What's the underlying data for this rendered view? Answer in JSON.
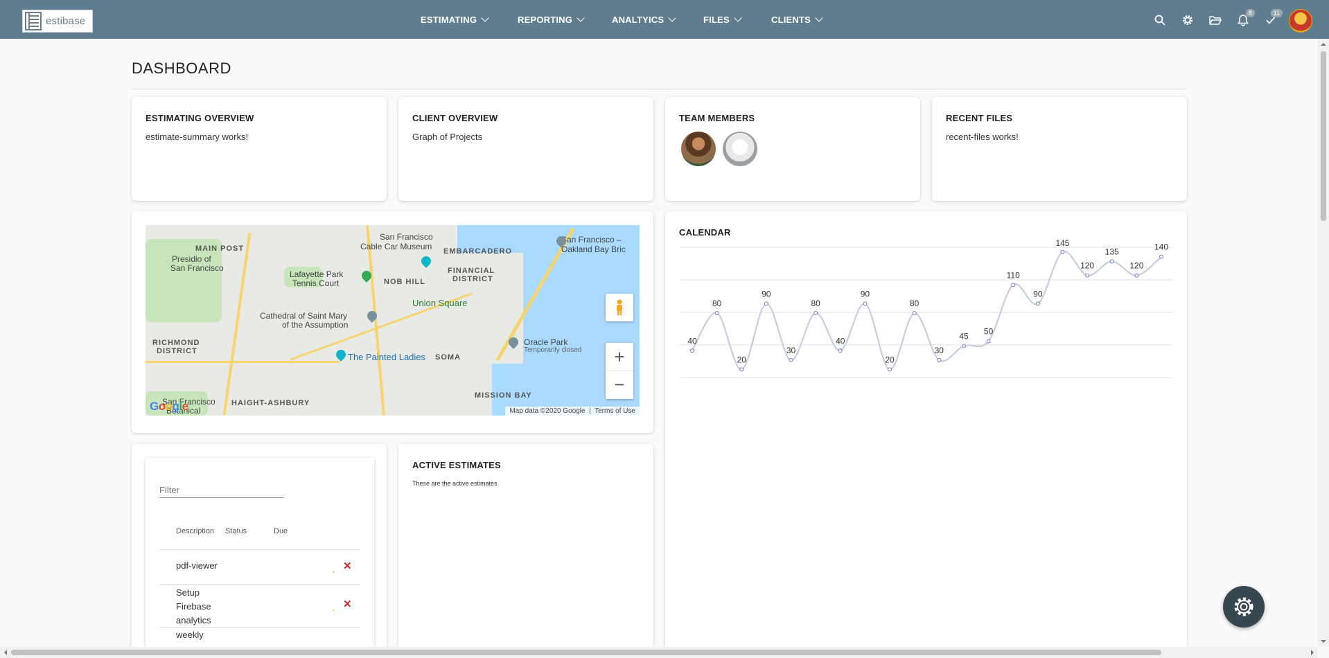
{
  "app": {
    "logo_text": "estibase"
  },
  "nav": {
    "items": [
      {
        "label": "ESTIMATING"
      },
      {
        "label": "REPORTING"
      },
      {
        "label": "ANALTYICS"
      },
      {
        "label": "FILES"
      },
      {
        "label": "CLIENTS"
      }
    ]
  },
  "toolbar": {
    "notifications_count": "8",
    "tasks_count": "11"
  },
  "page": {
    "title": "DASHBOARD"
  },
  "cards": {
    "estimating": {
      "title": "ESTIMATING OVERVIEW",
      "text": "estimate-summary works!"
    },
    "client": {
      "title": "CLIENT OVERVIEW",
      "text": "Graph of Projects"
    },
    "team": {
      "title": "TEAM MEMBERS"
    },
    "recent": {
      "title": "RECENT FILES",
      "text": "recent-files works!"
    },
    "calendar": {
      "title": "CALENDAR"
    },
    "active": {
      "title": "ACTIVE ESTIMATES",
      "text": "These are the active estimates"
    }
  },
  "map": {
    "labels": {
      "sf_cable": "San Francisco",
      "sf_cable2": "Cable Car Museum",
      "embarcadero": "EMBARCADERO",
      "sf_oak": "San Francisco –",
      "sf_oak2": "Oakland Bay Bric",
      "main_post": "MAIN POST",
      "presidio": "Presidio of",
      "presidio2": "San Francisco",
      "lafayette": "Lafayette Park",
      "lafayette2": "Tennis Court",
      "nob_hill": "NOB HILL",
      "financial": "FINANCIAL",
      "financial2": "DISTRICT",
      "union_square": "Union Square",
      "cathedral": "Cathedral of Saint Mary",
      "cathedral2": "of the Assumption",
      "richmond": "RICHMOND",
      "richmond2": "DISTRICT",
      "painted": "The Painted Ladies",
      "soma": "SOMA",
      "oracle": "Oracle Park",
      "oracle2": "Temporarily closed",
      "mission_bay": "MISSION BAY",
      "haight": "HAIGHT-ASHBURY",
      "sf_bot": "San Francisco",
      "sf_bot2": "Botanical"
    },
    "attribution": "Map data ©2020 Google",
    "terms": "Terms of Use",
    "google": "Google"
  },
  "todo": {
    "filter_placeholder": "Filter",
    "columns": [
      "Description",
      "Status",
      "Due"
    ],
    "rows": [
      {
        "description": "pdf-viewer"
      },
      {
        "description_lines": [
          "Setup",
          "Firebase",
          "analytics"
        ]
      },
      {
        "description": "weekly"
      }
    ]
  },
  "colors": {
    "nav_bg": "#5f7d8e",
    "delete": "#c62828"
  },
  "chart_data": {
    "type": "line",
    "title": "CALENDAR",
    "x": [
      1,
      2,
      3,
      4,
      5,
      6,
      7,
      8,
      9,
      10,
      11,
      12,
      13,
      14,
      15,
      16,
      17,
      18,
      19,
      20
    ],
    "values": [
      40,
      80,
      20,
      90,
      30,
      80,
      40,
      90,
      20,
      80,
      30,
      45,
      50,
      110,
      90,
      145,
      120,
      135,
      120,
      140
    ],
    "labels": [
      "40",
      "80",
      "20",
      "90",
      "30",
      "80",
      "40",
      "90",
      "20",
      "80",
      "30",
      "45",
      "50",
      "110",
      "90",
      "145",
      "120",
      "135",
      "120",
      "140"
    ],
    "ylim": [
      10,
      150
    ],
    "grid": true,
    "curve": "smooth"
  }
}
